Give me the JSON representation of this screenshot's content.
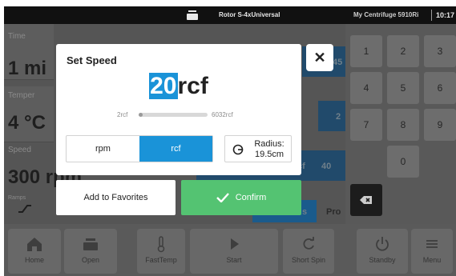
{
  "statusbar": {
    "rotor": "Rotor S-4xUniversal",
    "device": "My Centrifuge 5910Ri",
    "time": "10:17"
  },
  "background": {
    "time_label": "Time",
    "time_value": "1 mi",
    "temp_label": "Temper",
    "temp_value": "4 °C",
    "speed_label": "Speed",
    "speed_value": "300 rpm",
    "ramps_label": "Ramps",
    "right_col_1": "45",
    "right_col_2": "2",
    "right_col_3": "cf",
    "right_col_4": "40",
    "tab_s": "s",
    "tab_pro": "Pro"
  },
  "keypad": {
    "keys": [
      "1",
      "2",
      "3",
      "4",
      "5",
      "6",
      "7",
      "8",
      "9",
      "0"
    ]
  },
  "modal": {
    "title": "Set Speed",
    "speed_value": "20",
    "speed_unit": "rcf",
    "range_min": "2rcf",
    "range_max": "6032rcf",
    "range_fraction": 0.0,
    "unit_rpm": "rpm",
    "unit_rcf": "rcf",
    "active_unit": "rcf",
    "radius_label": "Radius:",
    "radius_value": "19.5cm",
    "close_glyph": "✕"
  },
  "actions": {
    "favorites": "Add to Favorites",
    "confirm": "Confirm"
  },
  "toolbar": {
    "home": "Home",
    "open": "Open",
    "fasttemp": "FastTemp",
    "start": "Start",
    "shortspin": "Short Spin",
    "standby": "Standby",
    "menu": "Menu"
  },
  "colors": {
    "accent_blue": "#1a93d8",
    "confirm_green": "#54c372",
    "statusbar": "#111111"
  }
}
